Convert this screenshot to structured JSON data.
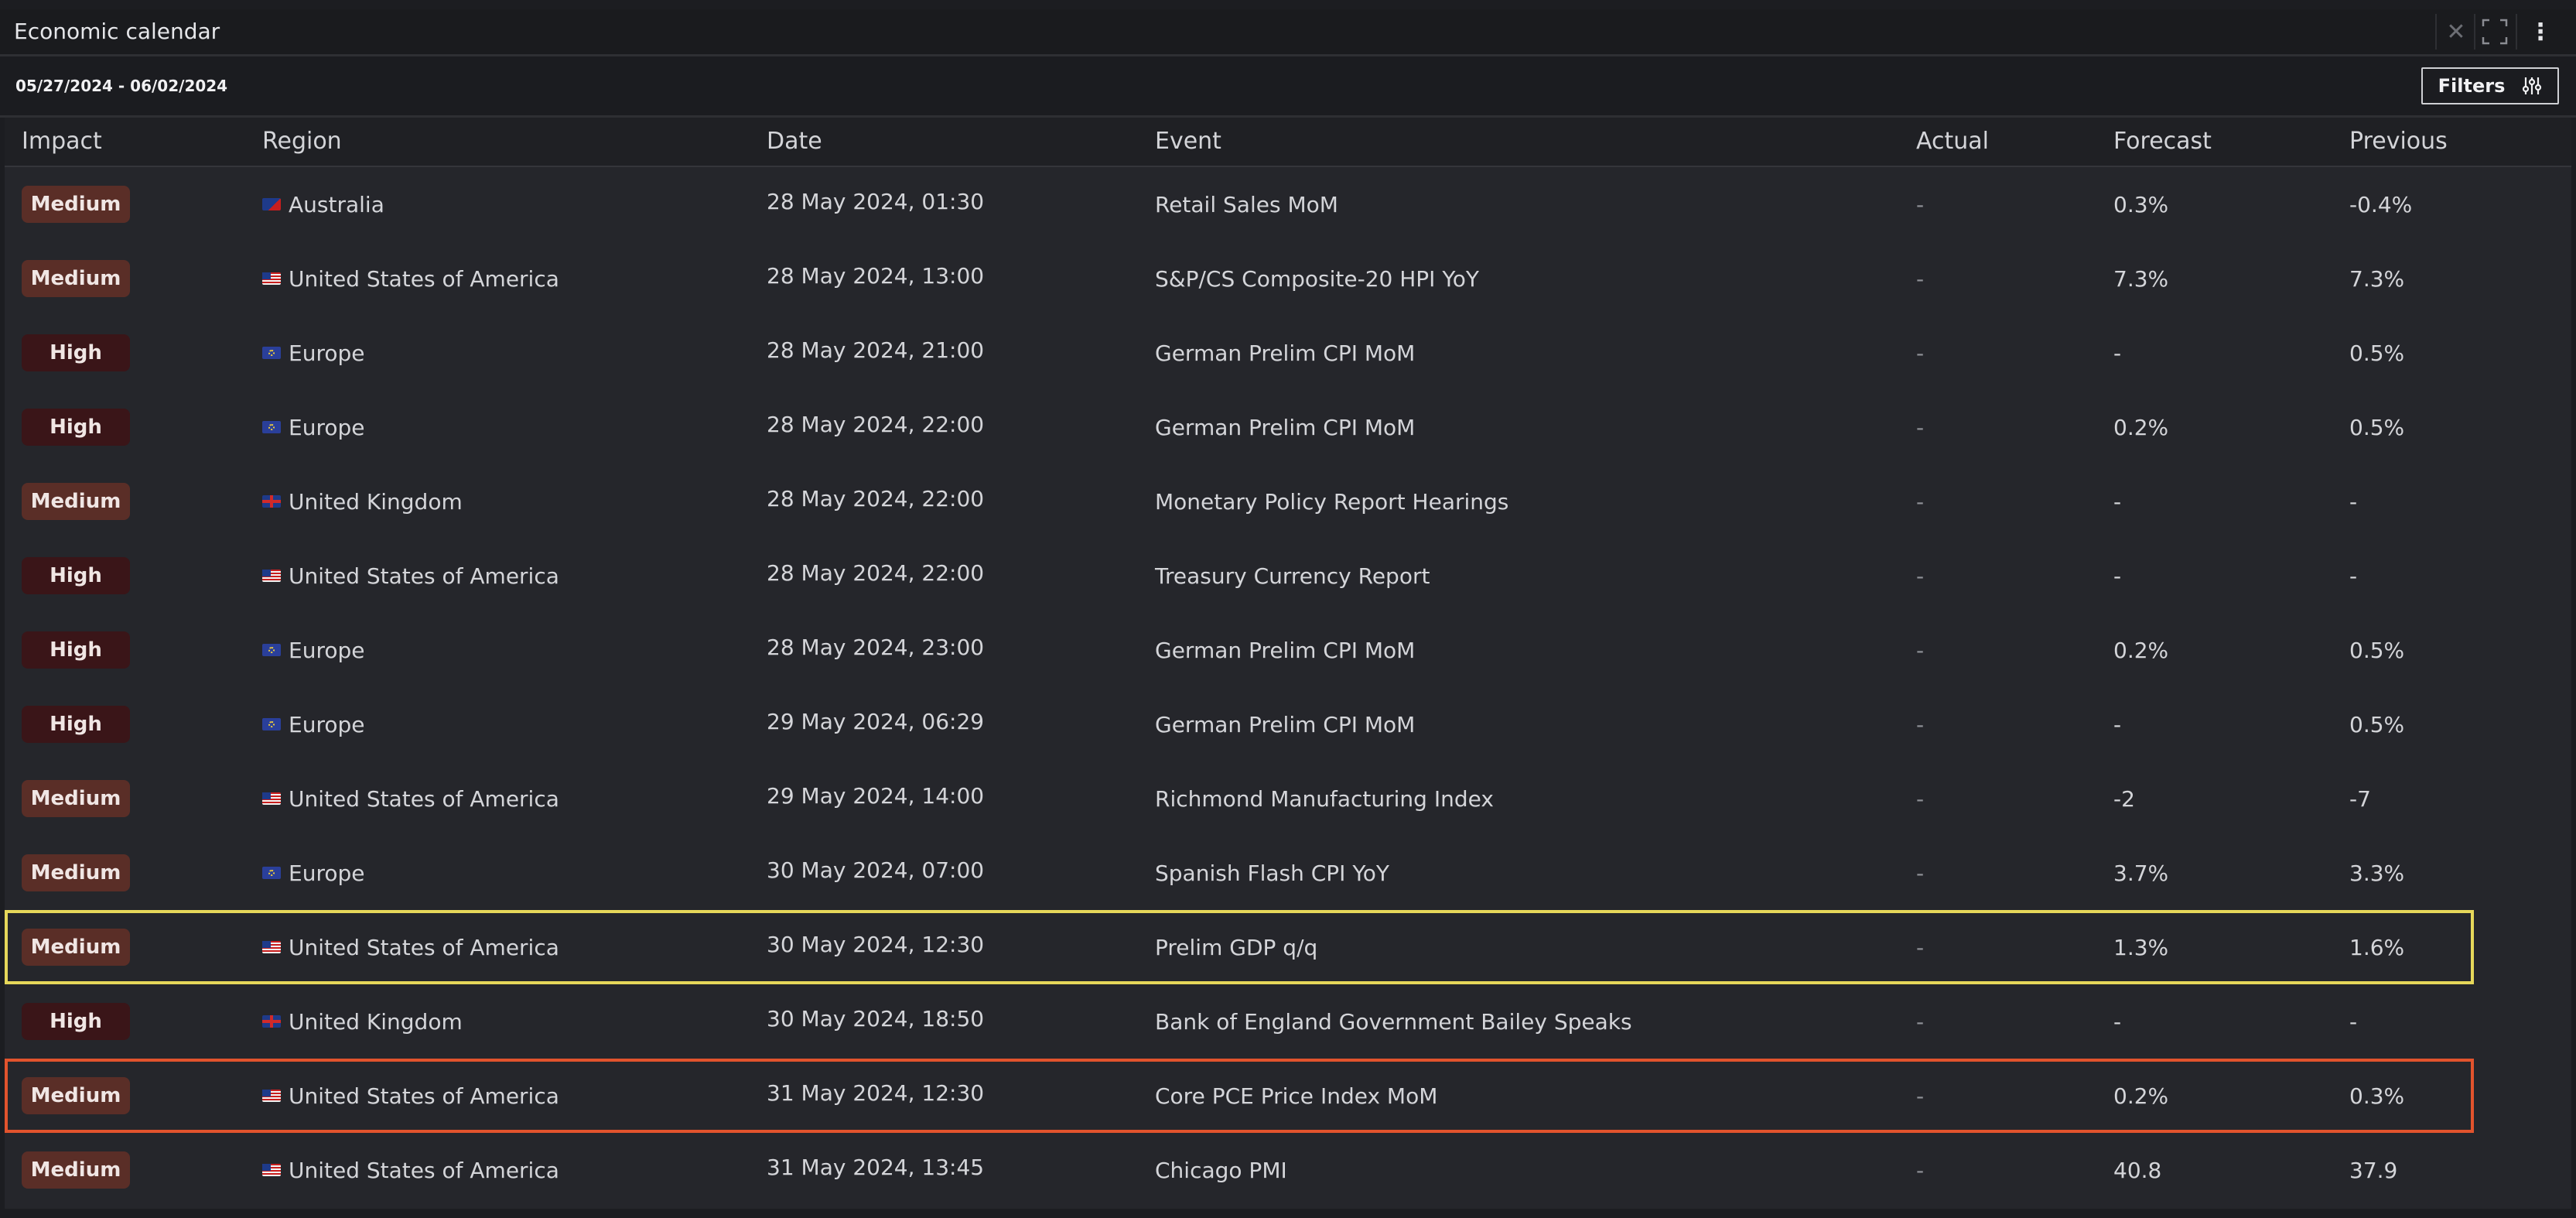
{
  "window": {
    "title": "Economic calendar"
  },
  "toolbar": {
    "date_range": "05/27/2024 - 06/02/2024",
    "filters_label": "Filters"
  },
  "colors": {
    "impact_medium_bg": "#5a2e27",
    "impact_high_bg": "#3a1518",
    "highlight_yellow": "#e6d75a",
    "highlight_red": "#e2532d"
  },
  "table": {
    "columns": [
      "Impact",
      "Region",
      "Date",
      "Event",
      "Actual",
      "Forecast",
      "Previous"
    ],
    "rows": [
      {
        "impact": "Medium",
        "flag": "au",
        "region": "Australia",
        "date": "28 May 2024, 01:30",
        "event": "Retail Sales MoM",
        "actual": "-",
        "forecast": "0.3%",
        "previous": "-0.4%",
        "highlight": ""
      },
      {
        "impact": "Medium",
        "flag": "us",
        "region": "United States of America",
        "date": "28 May 2024, 13:00",
        "event": "S&P/CS Composite-20 HPI YoY",
        "actual": "-",
        "forecast": "7.3%",
        "previous": "7.3%",
        "highlight": ""
      },
      {
        "impact": "High",
        "flag": "eu",
        "region": "Europe",
        "date": "28 May 2024, 21:00",
        "event": "German Prelim CPI MoM",
        "actual": "-",
        "forecast": "-",
        "previous": "0.5%",
        "highlight": ""
      },
      {
        "impact": "High",
        "flag": "eu",
        "region": "Europe",
        "date": "28 May 2024, 22:00",
        "event": "German Prelim CPI MoM",
        "actual": "-",
        "forecast": "0.2%",
        "previous": "0.5%",
        "highlight": ""
      },
      {
        "impact": "Medium",
        "flag": "uk",
        "region": "United Kingdom",
        "date": "28 May 2024, 22:00",
        "event": "Monetary Policy Report Hearings",
        "actual": "-",
        "forecast": "-",
        "previous": "-",
        "highlight": ""
      },
      {
        "impact": "High",
        "flag": "us",
        "region": "United States of America",
        "date": "28 May 2024, 22:00",
        "event": "Treasury Currency Report",
        "actual": "-",
        "forecast": "-",
        "previous": "-",
        "highlight": ""
      },
      {
        "impact": "High",
        "flag": "eu",
        "region": "Europe",
        "date": "28 May 2024, 23:00",
        "event": "German Prelim CPI MoM",
        "actual": "-",
        "forecast": "0.2%",
        "previous": "0.5%",
        "highlight": ""
      },
      {
        "impact": "High",
        "flag": "eu",
        "region": "Europe",
        "date": "29 May 2024, 06:29",
        "event": "German Prelim CPI MoM",
        "actual": "-",
        "forecast": "-",
        "previous": "0.5%",
        "highlight": ""
      },
      {
        "impact": "Medium",
        "flag": "us",
        "region": "United States of America",
        "date": "29 May 2024, 14:00",
        "event": "Richmond Manufacturing Index",
        "actual": "-",
        "forecast": "-2",
        "previous": "-7",
        "highlight": ""
      },
      {
        "impact": "Medium",
        "flag": "eu",
        "region": "Europe",
        "date": "30 May 2024, 07:00",
        "event": "Spanish Flash CPI YoY",
        "actual": "-",
        "forecast": "3.7%",
        "previous": "3.3%",
        "highlight": ""
      },
      {
        "impact": "Medium",
        "flag": "us",
        "region": "United States of America",
        "date": "30 May 2024, 12:30",
        "event": "Prelim GDP q/q",
        "actual": "-",
        "forecast": "1.3%",
        "previous": "1.6%",
        "highlight": "yellow"
      },
      {
        "impact": "High",
        "flag": "uk",
        "region": "United Kingdom",
        "date": "30 May 2024, 18:50",
        "event": "Bank of England Government Bailey Speaks",
        "actual": "-",
        "forecast": "-",
        "previous": "-",
        "highlight": ""
      },
      {
        "impact": "Medium",
        "flag": "us",
        "region": "United States of America",
        "date": "31 May 2024, 12:30",
        "event": "Core PCE Price Index MoM",
        "actual": "-",
        "forecast": "0.2%",
        "previous": "0.3%",
        "highlight": "red"
      },
      {
        "impact": "Medium",
        "flag": "us",
        "region": "United States of America",
        "date": "31 May 2024, 13:45",
        "event": "Chicago PMI",
        "actual": "-",
        "forecast": "40.8",
        "previous": "37.9",
        "highlight": ""
      }
    ]
  }
}
